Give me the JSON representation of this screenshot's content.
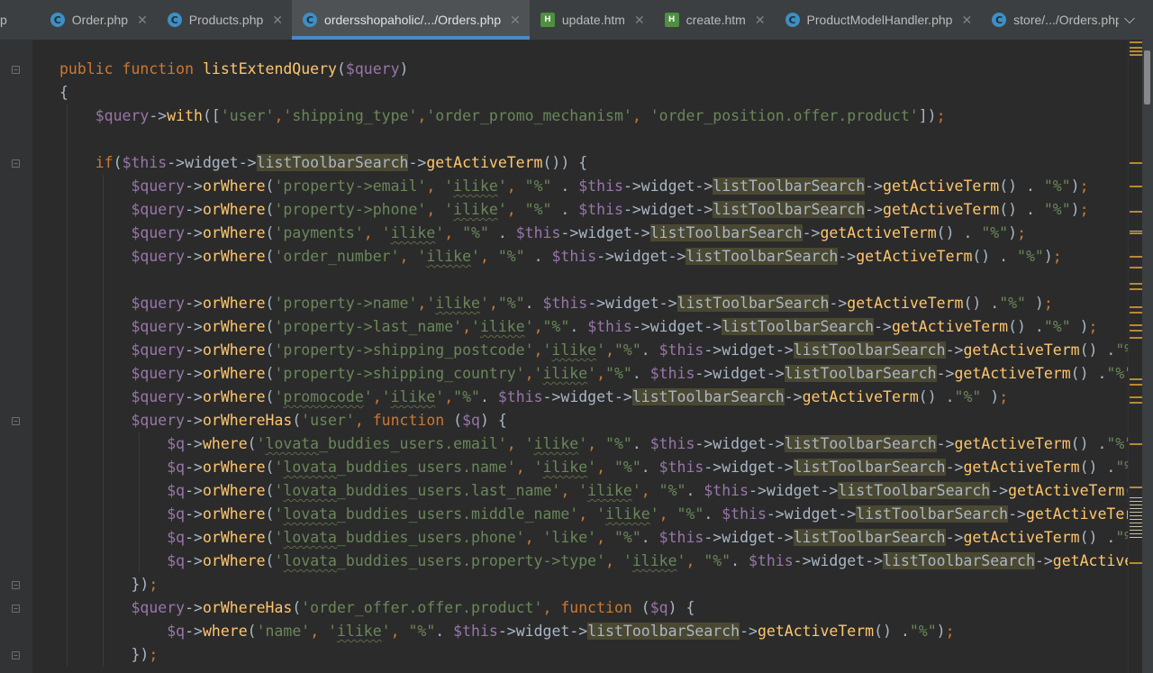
{
  "tabs": [
    {
      "label": "p",
      "icon": "php",
      "partial": true
    },
    {
      "label": "Order.php",
      "icon": "php"
    },
    {
      "label": "Products.php",
      "icon": "php"
    },
    {
      "label": "ordersshopaholic/.../Orders.php",
      "icon": "php",
      "active": true
    },
    {
      "label": "update.htm",
      "icon": "htm"
    },
    {
      "label": "create.htm",
      "icon": "htm"
    },
    {
      "label": "ProductModelHandler.php",
      "icon": "php"
    },
    {
      "label": "store/.../Orders.php",
      "icon": "php"
    }
  ],
  "code": [
    "public function listExtendQuery($query)",
    "{",
    "    $query->with(['user','shipping_type','order_promo_mechanism', 'order_position.offer.product']);",
    "",
    "    if($this->widget->listToolbarSearch->getActiveTerm()) {",
    "        $query->orWhere('property->email', 'ilike', \"%\" . $this->widget->listToolbarSearch->getActiveTerm() . \"%\");",
    "        $query->orWhere('property->phone', 'ilike', \"%\" . $this->widget->listToolbarSearch->getActiveTerm() . \"%\");",
    "        $query->orWhere('payments', 'ilike', \"%\" . $this->widget->listToolbarSearch->getActiveTerm() . \"%\");",
    "        $query->orWhere('order_number', 'ilike', \"%\" . $this->widget->listToolbarSearch->getActiveTerm() . \"%\");",
    "",
    "        $query->orWhere('property->name','ilike',\"%\". $this->widget->listToolbarSearch->getActiveTerm() .\"%\" );",
    "        $query->orWhere('property->last_name','ilike',\"%\". $this->widget->listToolbarSearch->getActiveTerm() .\"%\" );",
    "        $query->orWhere('property->shipping_postcode','ilike',\"%\". $this->widget->listToolbarSearch->getActiveTerm() .\"%\"",
    "        $query->orWhere('property->shipping_country','ilike',\"%\". $this->widget->listToolbarSearch->getActiveTerm() .\"%\" )",
    "        $query->orWhere('promocode','ilike',\"%\". $this->widget->listToolbarSearch->getActiveTerm() .\"%\" );",
    "        $query->orWhereHas('user', function ($q) {",
    "            $q->where('lovata_buddies_users.email', 'ilike', \"%\". $this->widget->listToolbarSearch->getActiveTerm() .\"%\");",
    "            $q->orWhere('lovata_buddies_users.name', 'ilike', \"%\". $this->widget->listToolbarSearch->getActiveTerm() .\"%\");",
    "            $q->orWhere('lovata_buddies_users.last_name', 'ilike', \"%\". $this->widget->listToolbarSearch->getActiveTerm() .",
    "            $q->orWhere('lovata_buddies_users.middle_name', 'ilike', \"%\". $this->widget->listToolbarSearch->getActiveTerm",
    "            $q->orWhere('lovata_buddies_users.phone', 'like', \"%\". $this->widget->listToolbarSearch->getActiveTerm() .\"%\");",
    "            $q->orWhere('lovata_buddies_users.property->type', 'ilike', \"%\". $this->widget->listToolbarSearch->getActive",
    "        });",
    "        $query->orWhereHas('order_offer.offer.product', function ($q) {",
    "            $q->where('name', 'ilike', \"%\". $this->widget->listToolbarSearch->getActiveTerm() .\"%\");",
    "        });"
  ],
  "colors": {
    "background": "#2b2b2b",
    "keyword": "#cc7832",
    "function": "#ffc66d",
    "variable": "#9876aa",
    "string": "#6a8759",
    "text": "#a9b7c6",
    "highlight": "#4b4832",
    "active_tab_underline": "#4a88c7"
  },
  "icons": [
    "php-file-icon",
    "htm-file-icon",
    "close-icon",
    "chevron-down-icon",
    "fold-icon"
  ]
}
